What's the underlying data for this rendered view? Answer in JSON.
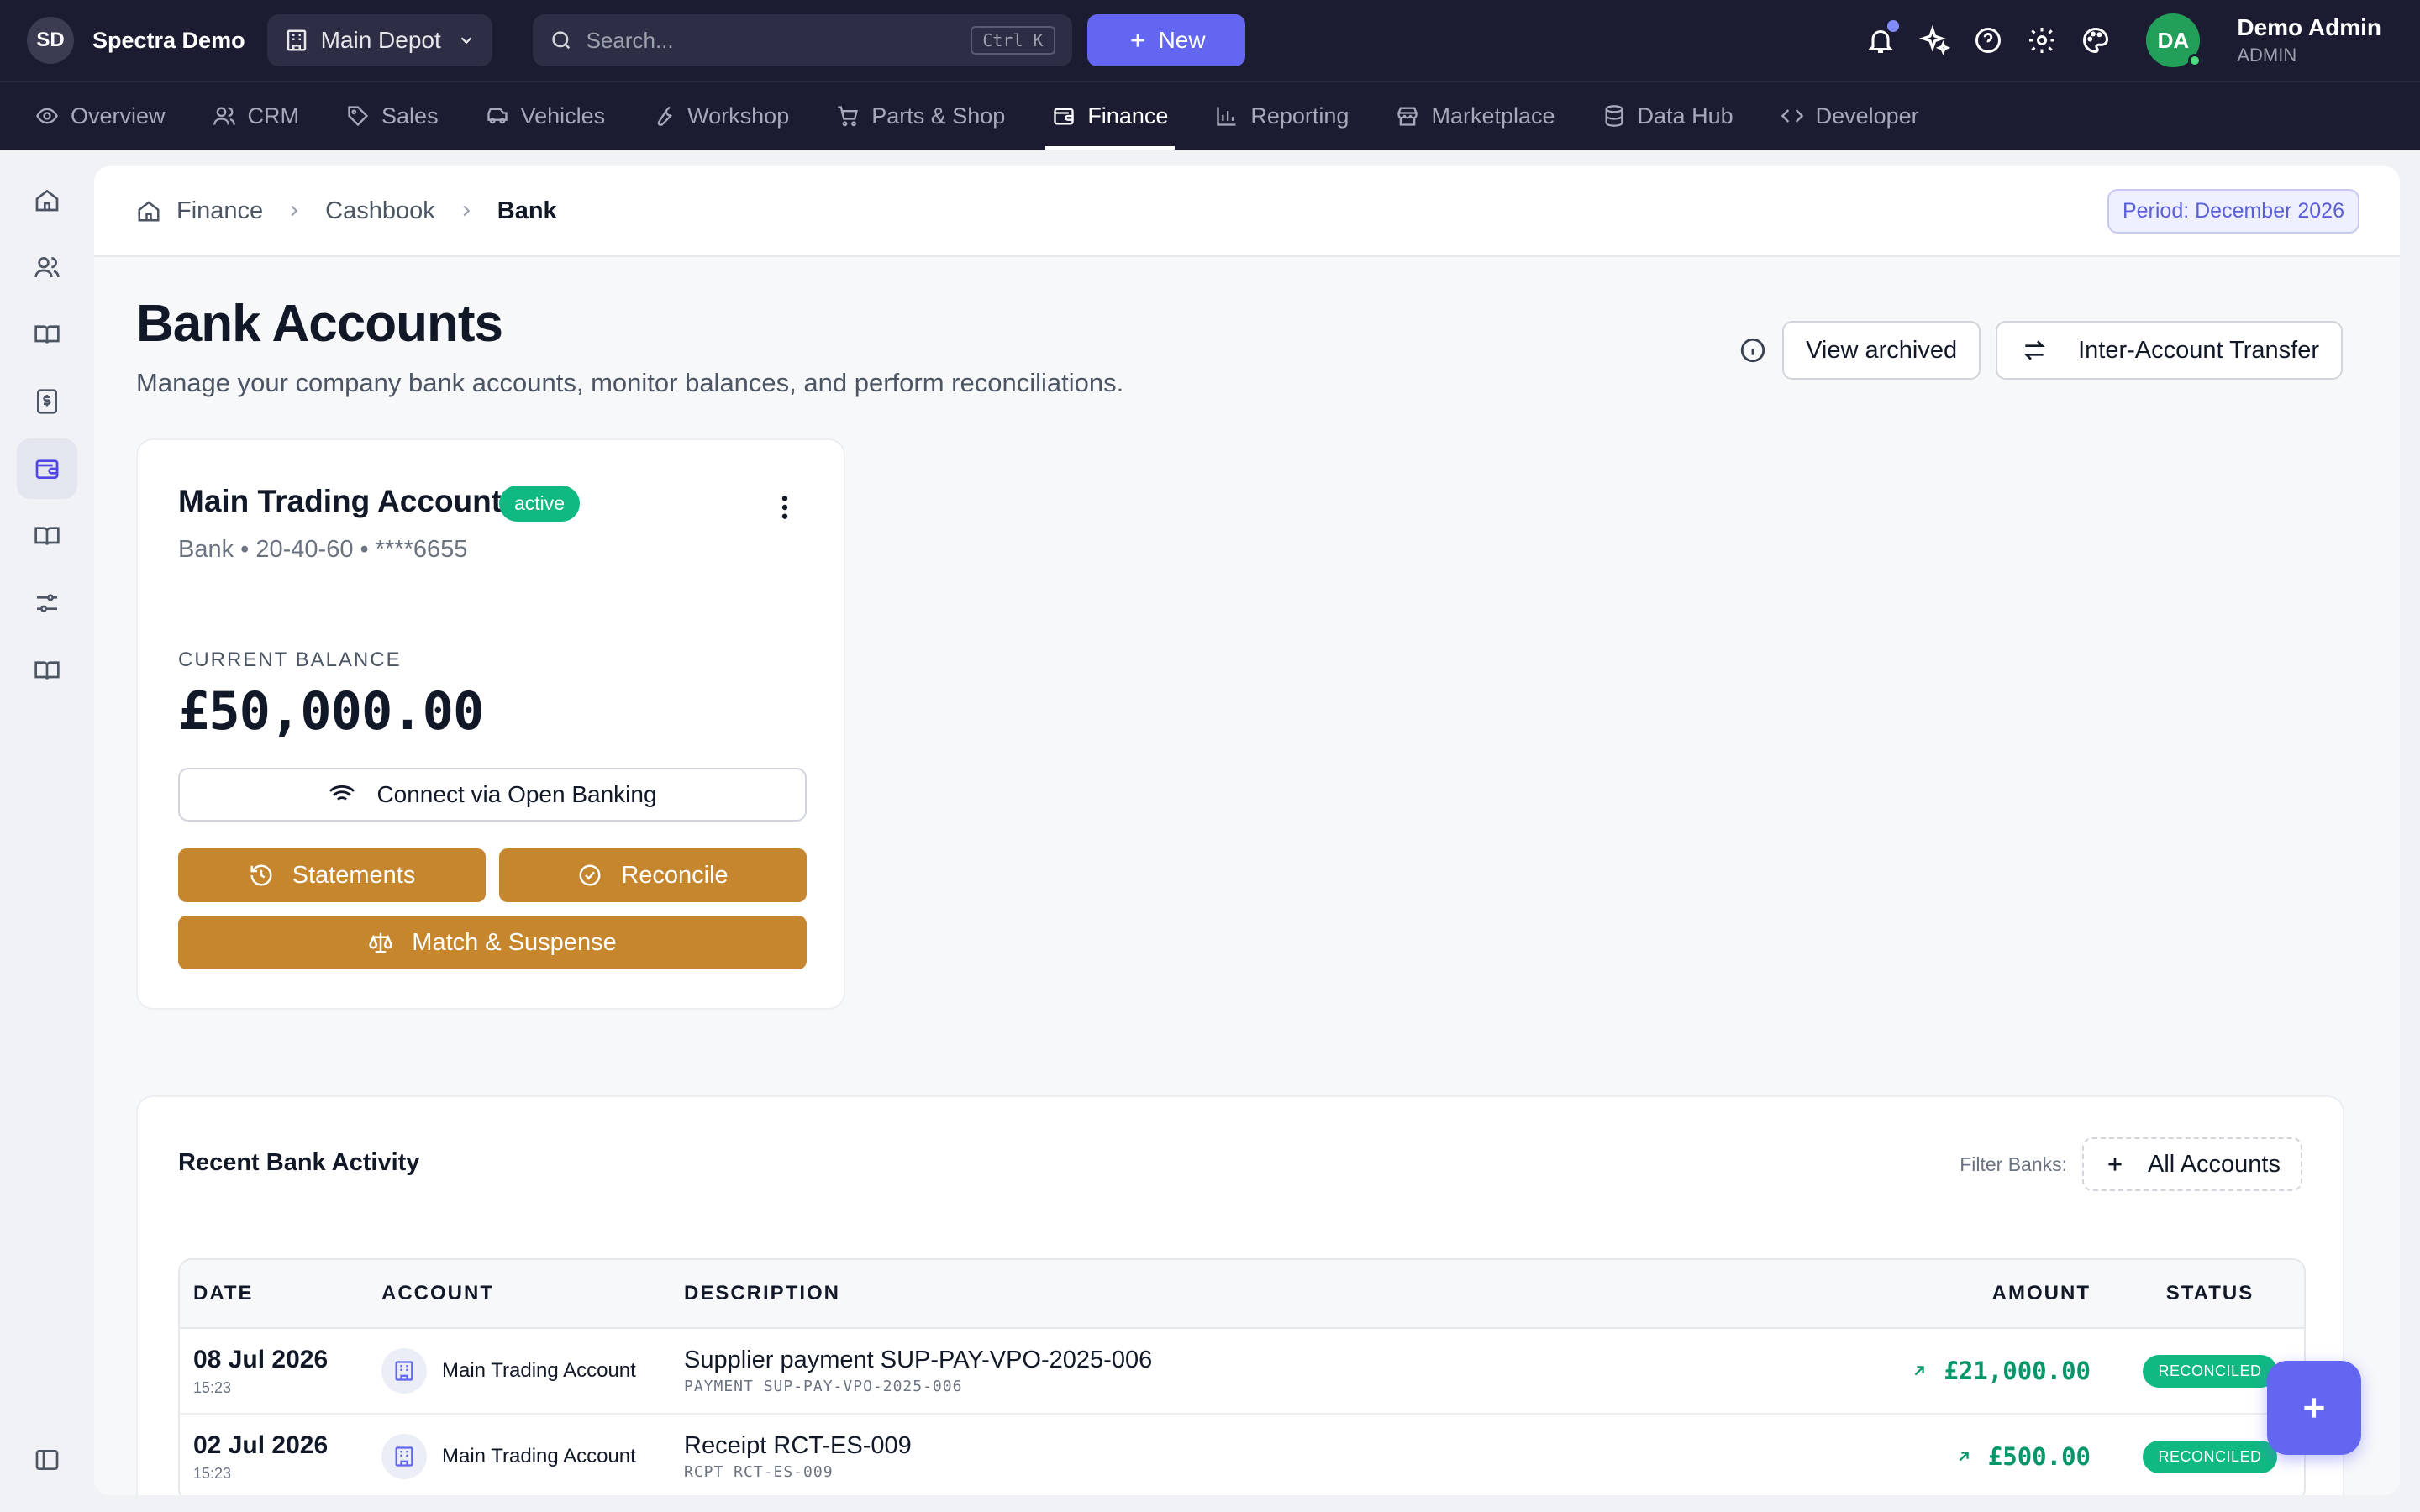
{
  "app": {
    "brand_initials": "SD",
    "brand_name": "Spectra Demo"
  },
  "topbar": {
    "depot": "Main Depot",
    "search_placeholder": "Search...",
    "search_shortcut": "Ctrl K",
    "new_label": "New",
    "user": {
      "initials": "DA",
      "name": "Demo Admin",
      "role": "ADMIN"
    }
  },
  "nav": [
    {
      "label": "Overview",
      "icon": "eye-icon"
    },
    {
      "label": "CRM",
      "icon": "users-icon"
    },
    {
      "label": "Sales",
      "icon": "tag-icon"
    },
    {
      "label": "Vehicles",
      "icon": "car-icon"
    },
    {
      "label": "Workshop",
      "icon": "wrench-icon"
    },
    {
      "label": "Parts & Shop",
      "icon": "cart-icon"
    },
    {
      "label": "Finance",
      "icon": "wallet-icon",
      "active": true
    },
    {
      "label": "Reporting",
      "icon": "bar-chart-icon"
    },
    {
      "label": "Marketplace",
      "icon": "store-icon"
    },
    {
      "label": "Data Hub",
      "icon": "database-icon"
    },
    {
      "label": "Developer",
      "icon": "code-icon"
    }
  ],
  "breadcrumb": [
    "Finance",
    "Cashbook",
    "Bank"
  ],
  "period": "Period: December 2026",
  "page": {
    "title": "Bank Accounts",
    "subtitle": "Manage your company bank accounts, monitor balances, and perform reconciliations.",
    "view_archived": "View archived",
    "transfer": "Inter-Account Transfer"
  },
  "account": {
    "name": "Main Trading Account",
    "status": "active",
    "meta": "Bank • 20-40-60 • ****6655",
    "balance_label": "CURRENT BALANCE",
    "balance": "£50,000.00",
    "open_banking": "Connect via Open Banking",
    "statements": "Statements",
    "reconcile": "Reconcile",
    "match": "Match & Suspense"
  },
  "activity": {
    "title": "Recent Bank Activity",
    "filter_label": "Filter Banks:",
    "filter_value": "All Accounts",
    "columns": [
      "DATE",
      "ACCOUNT",
      "DESCRIPTION",
      "AMOUNT",
      "STATUS"
    ],
    "rows": [
      {
        "date": "08 Jul 2026",
        "time": "15:23",
        "account": "Main Trading Account",
        "description": "Supplier payment SUP-PAY-VPO-2025-006",
        "ref": "PAYMENT SUP-PAY-VPO-2025-006",
        "amount": "£21,000.00",
        "status": "RECONCILED"
      },
      {
        "date": "02 Jul 2026",
        "time": "15:23",
        "account": "Main Trading Account",
        "description": "Receipt RCT-ES-009",
        "ref": "RCPT RCT-ES-009",
        "amount": "£500.00",
        "status": "RECONCILED"
      }
    ]
  }
}
